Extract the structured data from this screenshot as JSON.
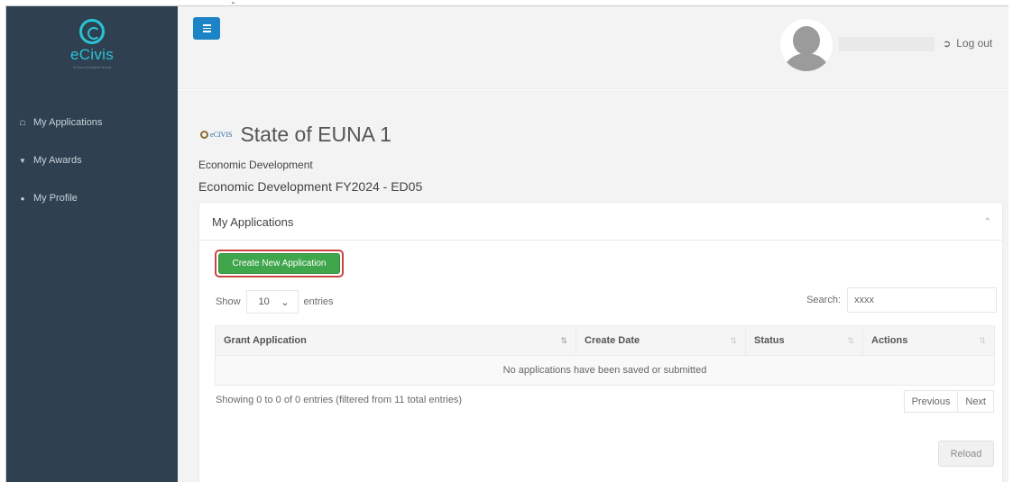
{
  "brand": {
    "name": "eCivis",
    "tagline": "A Euna Solutions Brand",
    "accent": "#29c3d6",
    "sidebar_color": "#2f4050",
    "primary_button_color": "#3fa64b"
  },
  "sidebar": {
    "items": [
      {
        "icon": "home-icon",
        "label": "My Applications"
      },
      {
        "icon": "trophy-icon",
        "label": "My Awards"
      },
      {
        "icon": "user-icon",
        "label": "My Profile"
      }
    ]
  },
  "header": {
    "menu_toggle_icon": "hamburger-icon",
    "logout_label": "Log out",
    "logout_icon": "sign-out-icon"
  },
  "page": {
    "org_logo_text": "eCIVIS",
    "org_title": "State of EUNA 1",
    "program": "Economic Development",
    "subprogram": "Economic Development FY2024 - ED05"
  },
  "panel": {
    "title": "My Applications",
    "create_label": "Create New Application",
    "show_label": "Show",
    "show_value": "10",
    "entries_label": "entries",
    "search_label": "Search:",
    "search_value": "xxxx",
    "columns": [
      "Grant Application",
      "Create Date",
      "Status",
      "Actions"
    ],
    "empty_message": "No applications have been saved or submitted",
    "info": "Showing 0 to 0 of 0 entries (filtered from 11 total entries)",
    "previous_label": "Previous",
    "next_label": "Next",
    "reload_label": "Reload"
  }
}
